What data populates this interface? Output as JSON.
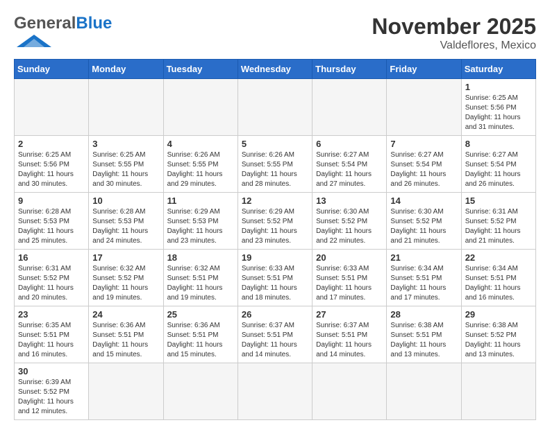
{
  "header": {
    "logo_general": "General",
    "logo_blue": "Blue",
    "month_title": "November 2025",
    "location": "Valdeflores, Mexico"
  },
  "weekdays": [
    "Sunday",
    "Monday",
    "Tuesday",
    "Wednesday",
    "Thursday",
    "Friday",
    "Saturday"
  ],
  "days": {
    "d1": {
      "num": "1",
      "sunrise": "6:25 AM",
      "sunset": "5:56 PM",
      "daylight": "11 hours and 31 minutes."
    },
    "d2": {
      "num": "2",
      "sunrise": "6:25 AM",
      "sunset": "5:56 PM",
      "daylight": "11 hours and 30 minutes."
    },
    "d3": {
      "num": "3",
      "sunrise": "6:25 AM",
      "sunset": "5:55 PM",
      "daylight": "11 hours and 30 minutes."
    },
    "d4": {
      "num": "4",
      "sunrise": "6:26 AM",
      "sunset": "5:55 PM",
      "daylight": "11 hours and 29 minutes."
    },
    "d5": {
      "num": "5",
      "sunrise": "6:26 AM",
      "sunset": "5:55 PM",
      "daylight": "11 hours and 28 minutes."
    },
    "d6": {
      "num": "6",
      "sunrise": "6:27 AM",
      "sunset": "5:54 PM",
      "daylight": "11 hours and 27 minutes."
    },
    "d7": {
      "num": "7",
      "sunrise": "6:27 AM",
      "sunset": "5:54 PM",
      "daylight": "11 hours and 26 minutes."
    },
    "d8": {
      "num": "8",
      "sunrise": "6:27 AM",
      "sunset": "5:54 PM",
      "daylight": "11 hours and 26 minutes."
    },
    "d9": {
      "num": "9",
      "sunrise": "6:28 AM",
      "sunset": "5:53 PM",
      "daylight": "11 hours and 25 minutes."
    },
    "d10": {
      "num": "10",
      "sunrise": "6:28 AM",
      "sunset": "5:53 PM",
      "daylight": "11 hours and 24 minutes."
    },
    "d11": {
      "num": "11",
      "sunrise": "6:29 AM",
      "sunset": "5:53 PM",
      "daylight": "11 hours and 23 minutes."
    },
    "d12": {
      "num": "12",
      "sunrise": "6:29 AM",
      "sunset": "5:52 PM",
      "daylight": "11 hours and 23 minutes."
    },
    "d13": {
      "num": "13",
      "sunrise": "6:30 AM",
      "sunset": "5:52 PM",
      "daylight": "11 hours and 22 minutes."
    },
    "d14": {
      "num": "14",
      "sunrise": "6:30 AM",
      "sunset": "5:52 PM",
      "daylight": "11 hours and 21 minutes."
    },
    "d15": {
      "num": "15",
      "sunrise": "6:31 AM",
      "sunset": "5:52 PM",
      "daylight": "11 hours and 21 minutes."
    },
    "d16": {
      "num": "16",
      "sunrise": "6:31 AM",
      "sunset": "5:52 PM",
      "daylight": "11 hours and 20 minutes."
    },
    "d17": {
      "num": "17",
      "sunrise": "6:32 AM",
      "sunset": "5:52 PM",
      "daylight": "11 hours and 19 minutes."
    },
    "d18": {
      "num": "18",
      "sunrise": "6:32 AM",
      "sunset": "5:51 PM",
      "daylight": "11 hours and 19 minutes."
    },
    "d19": {
      "num": "19",
      "sunrise": "6:33 AM",
      "sunset": "5:51 PM",
      "daylight": "11 hours and 18 minutes."
    },
    "d20": {
      "num": "20",
      "sunrise": "6:33 AM",
      "sunset": "5:51 PM",
      "daylight": "11 hours and 17 minutes."
    },
    "d21": {
      "num": "21",
      "sunrise": "6:34 AM",
      "sunset": "5:51 PM",
      "daylight": "11 hours and 17 minutes."
    },
    "d22": {
      "num": "22",
      "sunrise": "6:34 AM",
      "sunset": "5:51 PM",
      "daylight": "11 hours and 16 minutes."
    },
    "d23": {
      "num": "23",
      "sunrise": "6:35 AM",
      "sunset": "5:51 PM",
      "daylight": "11 hours and 16 minutes."
    },
    "d24": {
      "num": "24",
      "sunrise": "6:36 AM",
      "sunset": "5:51 PM",
      "daylight": "11 hours and 15 minutes."
    },
    "d25": {
      "num": "25",
      "sunrise": "6:36 AM",
      "sunset": "5:51 PM",
      "daylight": "11 hours and 15 minutes."
    },
    "d26": {
      "num": "26",
      "sunrise": "6:37 AM",
      "sunset": "5:51 PM",
      "daylight": "11 hours and 14 minutes."
    },
    "d27": {
      "num": "27",
      "sunrise": "6:37 AM",
      "sunset": "5:51 PM",
      "daylight": "11 hours and 14 minutes."
    },
    "d28": {
      "num": "28",
      "sunrise": "6:38 AM",
      "sunset": "5:51 PM",
      "daylight": "11 hours and 13 minutes."
    },
    "d29": {
      "num": "29",
      "sunrise": "6:38 AM",
      "sunset": "5:52 PM",
      "daylight": "11 hours and 13 minutes."
    },
    "d30": {
      "num": "30",
      "sunrise": "6:39 AM",
      "sunset": "5:52 PM",
      "daylight": "11 hours and 12 minutes."
    }
  },
  "labels": {
    "sunrise": "Sunrise:",
    "sunset": "Sunset:",
    "daylight": "Daylight:"
  }
}
